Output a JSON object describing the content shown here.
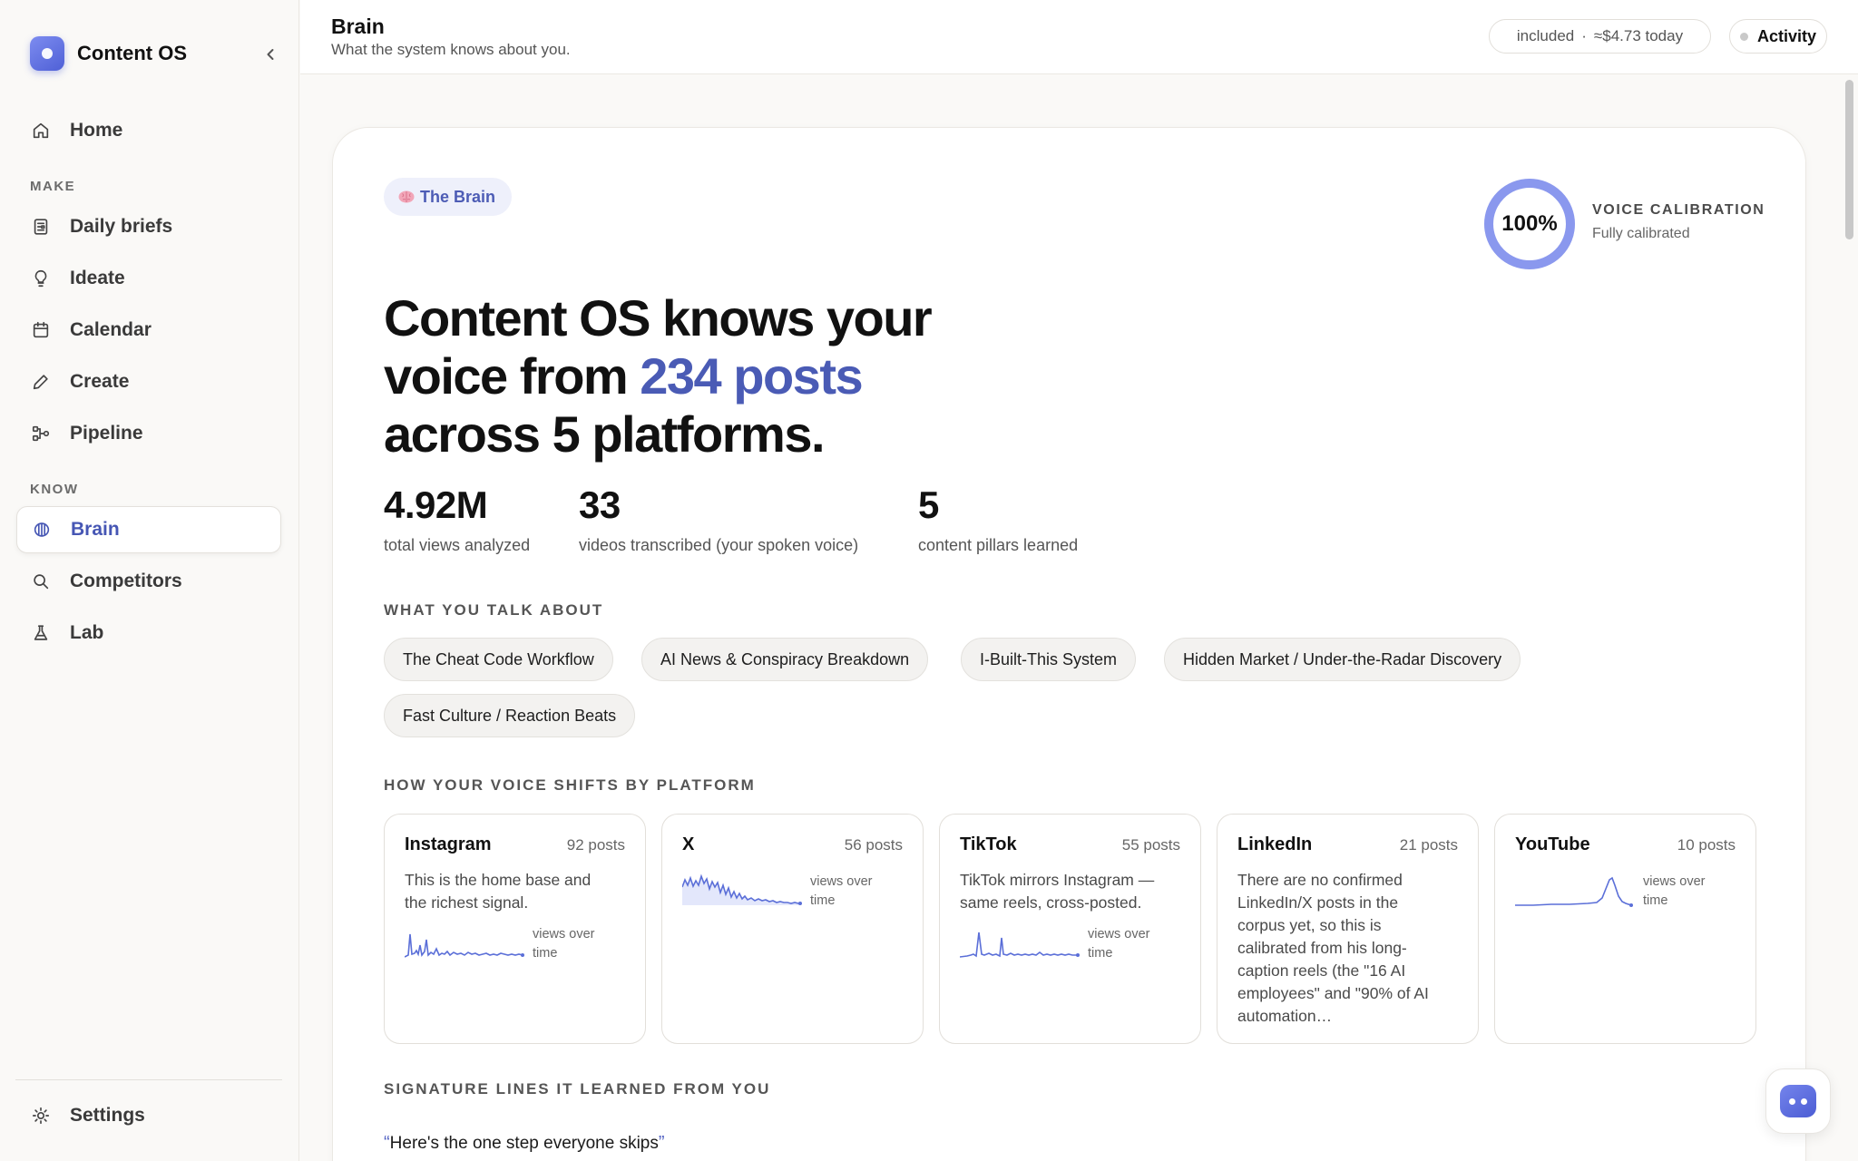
{
  "app": {
    "name": "Content OS"
  },
  "sidebar": {
    "home": "Home",
    "sections": {
      "make": "MAKE",
      "know": "KNOW"
    },
    "make_items": [
      {
        "label": "Daily briefs",
        "icon": "newspaper-icon"
      },
      {
        "label": "Ideate",
        "icon": "lightbulb-icon"
      },
      {
        "label": "Calendar",
        "icon": "calendar-icon"
      },
      {
        "label": "Create",
        "icon": "pencil-icon"
      },
      {
        "label": "Pipeline",
        "icon": "pipeline-icon"
      }
    ],
    "know_items": [
      {
        "label": "Brain",
        "icon": "brain-icon",
        "active": true
      },
      {
        "label": "Competitors",
        "icon": "search-icon"
      },
      {
        "label": "Lab",
        "icon": "flask-icon"
      }
    ],
    "settings": "Settings"
  },
  "header": {
    "title": "Brain",
    "subtitle": "What the system knows about you.",
    "cost": {
      "plan": "included",
      "separator": "·",
      "amount": "≈$4.73 today"
    },
    "activity": "Activity"
  },
  "brain": {
    "chip": "The Brain",
    "calibration": {
      "percent": 100,
      "percent_label": "100%",
      "label": "VOICE CALIBRATION",
      "status": "Fully calibrated"
    },
    "headline": {
      "pre": "Content OS knows your voice from ",
      "highlight": "234 posts",
      "post": " across 5 platforms."
    },
    "stats": [
      {
        "value": "4.92M",
        "caption": "total views analyzed"
      },
      {
        "value": "33",
        "caption": "videos transcribed (your spoken voice)"
      },
      {
        "value": "5",
        "caption": "content pillars learned"
      }
    ],
    "topics_label": "WHAT YOU TALK ABOUT",
    "topics": [
      "The Cheat Code Workflow",
      "AI News & Conspiracy Breakdown",
      "I-Built-This System",
      "Hidden Market / Under-the-Radar Discovery",
      "Fast Culture / Reaction Beats"
    ],
    "platforms_label": "HOW YOUR VOICE SHIFTS BY PLATFORM",
    "platforms": [
      {
        "name": "Instagram",
        "count": "92 posts",
        "desc": "This is the home base and the richest signal.",
        "spark_caption": "views over time"
      },
      {
        "name": "X",
        "count": "56 posts",
        "desc": "",
        "spark_caption": "views over time"
      },
      {
        "name": "TikTok",
        "count": "55 posts",
        "desc": "TikTok mirrors Instagram — same reels, cross-posted.",
        "spark_caption": "views over time"
      },
      {
        "name": "LinkedIn",
        "count": "21 posts",
        "desc": "There are no confirmed LinkedIn/X posts in the corpus yet, so this is calibrated from his long-caption reels (the \"16 AI employees\" and \"90% of AI automation…",
        "spark_caption": ""
      },
      {
        "name": "YouTube",
        "count": "10 posts",
        "desc": "",
        "spark_caption": "views over time"
      }
    ],
    "signature_label": "SIGNATURE LINES IT LEARNED FROM YOU",
    "signature_lines": [
      "Here's the one step everyone skips"
    ]
  },
  "colors": {
    "accent": "#4a5bb5",
    "spark": "#5b6fd8"
  }
}
